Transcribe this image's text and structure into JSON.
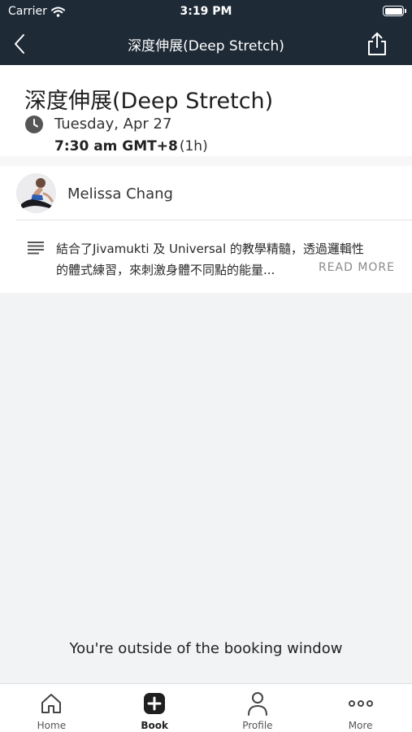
{
  "status_bar": {
    "carrier": "Carrier",
    "time": "3:19 PM"
  },
  "nav": {
    "title": "深度伸展(Deep Stretch)"
  },
  "class": {
    "title": "深度伸展(Deep Stretch)",
    "date": "Tuesday, Apr 27",
    "time": "7:30 am GMT+8",
    "duration": "(1h)",
    "teacher": "Melissa Chang",
    "description_line1": "結合了Jivamukti 及 Universal 的教學精髓，透過邏輯性",
    "description_line2": "的體式練習，來刺激身體不同點的能量...",
    "read_more": "READ MORE"
  },
  "booking_message": "You're outside of the booking window",
  "tabs": [
    {
      "label": "Home",
      "icon": "home-icon"
    },
    {
      "label": "Book",
      "icon": "plus-square-icon"
    },
    {
      "label": "Profile",
      "icon": "user-icon"
    },
    {
      "label": "More",
      "icon": "more-dots-icon"
    }
  ],
  "colors": {
    "header_bg": "#1e2a36",
    "page_bg": "#f2f3f5",
    "card_bg": "#ffffff"
  }
}
